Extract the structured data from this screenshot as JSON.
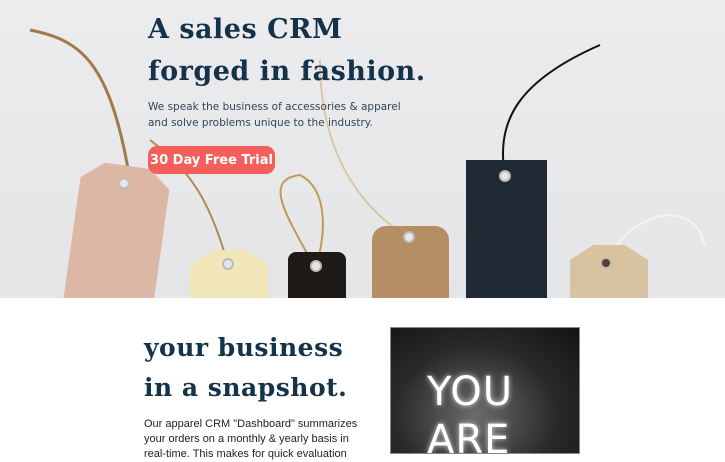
{
  "hero": {
    "title_line1": "A sales CRM",
    "title_line2": "forged in fashion.",
    "subtitle_line1": "We speak the business of accessories & apparel",
    "subtitle_line2": "and solve problems unique to the industry.",
    "cta_label": "30 Day Free Trial",
    "cta_color": "#f45f5c"
  },
  "snapshot": {
    "title_line1": "your business",
    "title_line2": "in a snapshot.",
    "body": "Our apparel CRM \"Dashboard\" summarizes your orders on a monthly & yearly basis in real-time. This makes for quick evaluation",
    "image_text_line1": "YOU",
    "image_text_line2": "ARE"
  },
  "colors": {
    "heading": "#14324a"
  }
}
